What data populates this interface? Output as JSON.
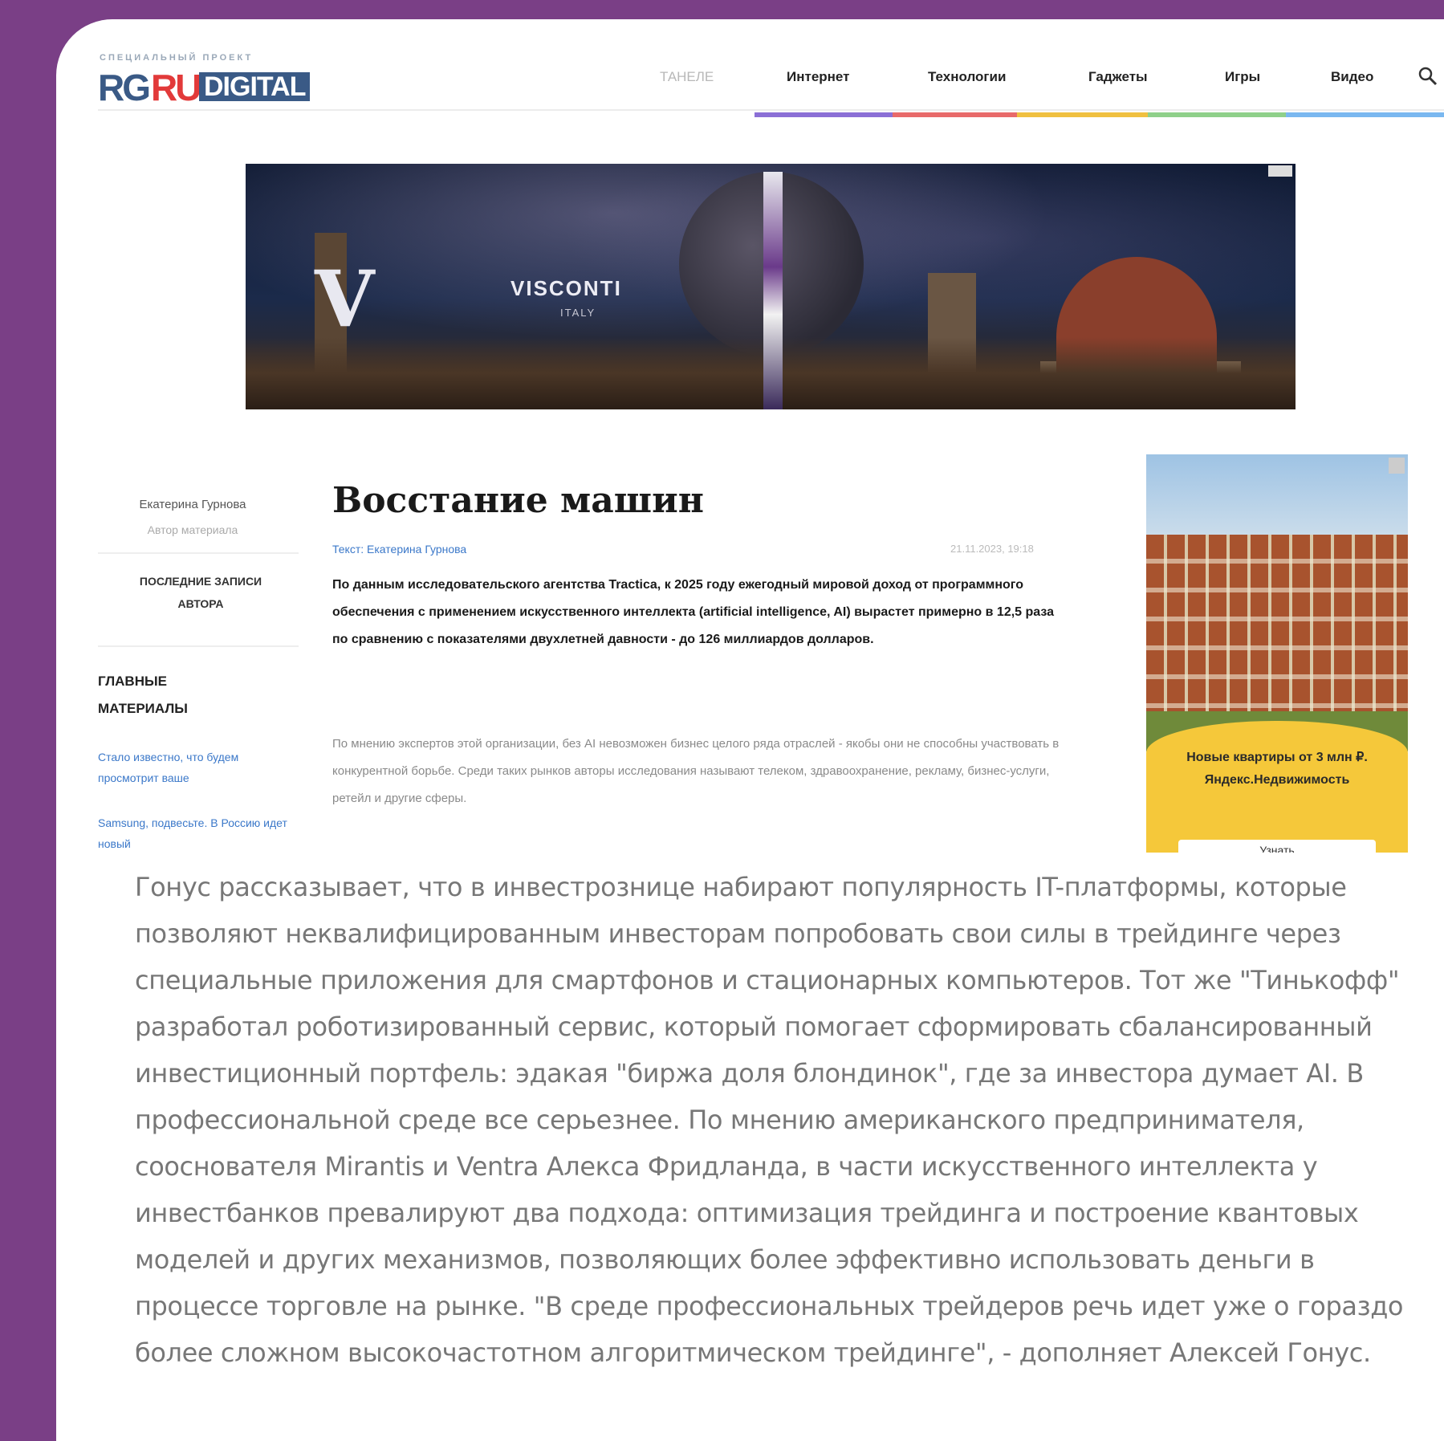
{
  "header": {
    "logo_tagline": "СПЕЦИАЛЬНЫЙ ПРОЕКТ",
    "logo_rg": "RG",
    "logo_ru": "RU",
    "logo_digital": "DIGITAL",
    "nav": [
      "ТАНЕЛЕ",
      "Интернет",
      "Технологии",
      "Гаджеты",
      "Игры",
      "Видео"
    ]
  },
  "banner": {
    "brand": "VISCONTI",
    "brand_sub": "ITALY",
    "letter": "V"
  },
  "sidebar": {
    "author_name": "Екатерина Гурнова",
    "author_role": "Автор материала",
    "latest_label": "Последние записи автора",
    "main_materials_label": "Главные материалы",
    "links": [
      "Стало известно, что будем просмотрит ваше",
      "Samsung, подвесьте. В Россию идет новый"
    ]
  },
  "article": {
    "title": "Восстание машин",
    "byline": "Текст: Екатерина Гурнова",
    "date": "21.11.2023, 19:18",
    "lead": "По данным исследовательского агентства Tractica, к 2025 году ежегодный мировой доход от программного обеспечения с применением искусственного интеллекта (artificial intelligence, AI) вырастет примерно в 12,5 раза по сравнению с показателями двухлетней давности - до 126 миллиардов долларов.",
    "paragraph": "По мнению экспертов этой организации, без AI невозможен бизнес целого ряда отраслей - якобы они не способны участвовать в конкурентной борьбе. Среди таких рынков авторы исследования называют телеком, здравоохранение, рекламу, бизнес-услуги, ретейл и другие сферы."
  },
  "side_ad": {
    "text": "Новые квартиры от 3 млн ₽. Яндекс.Недвижимость",
    "button": "Узнать"
  },
  "body_text": "Гонус рассказывает, что в инвестрознице набирают популярность IT-платформы, которые позволяют неквалифицированным инвесторам попробовать свои силы в трейдинге через специальные приложения для смартфонов и стационарных компьютеров. Тот же \"Тинькофф\" разработал роботизированный сервис, который помогает сформировать сбалансированный инвестиционный портфель: эдакая \"биржа доля блондинок\", где за инвестора думает AI. В профессиональной среде все серьезнее. По мнению американского предпринимателя, сооснователя Mirantis и Ventra Алекса Фридланда, в части искусственного интеллекта у инвестбанков превалируют два подхода: оптимизация трейдинга и построение квантовых моделей и других механизмов, позволяющих более эффективно использовать деньги в процессе торговле на рынке. \"В среде профессиональных трейдеров речь идет уже о гораздо более сложном высокочастотном алгоритмическом трейдинге\", - дополняет Алексей Гонус.",
  "colors": {
    "background": "#7a3f86",
    "link": "#3b78c9",
    "ad_yellow": "#f5c83a"
  }
}
